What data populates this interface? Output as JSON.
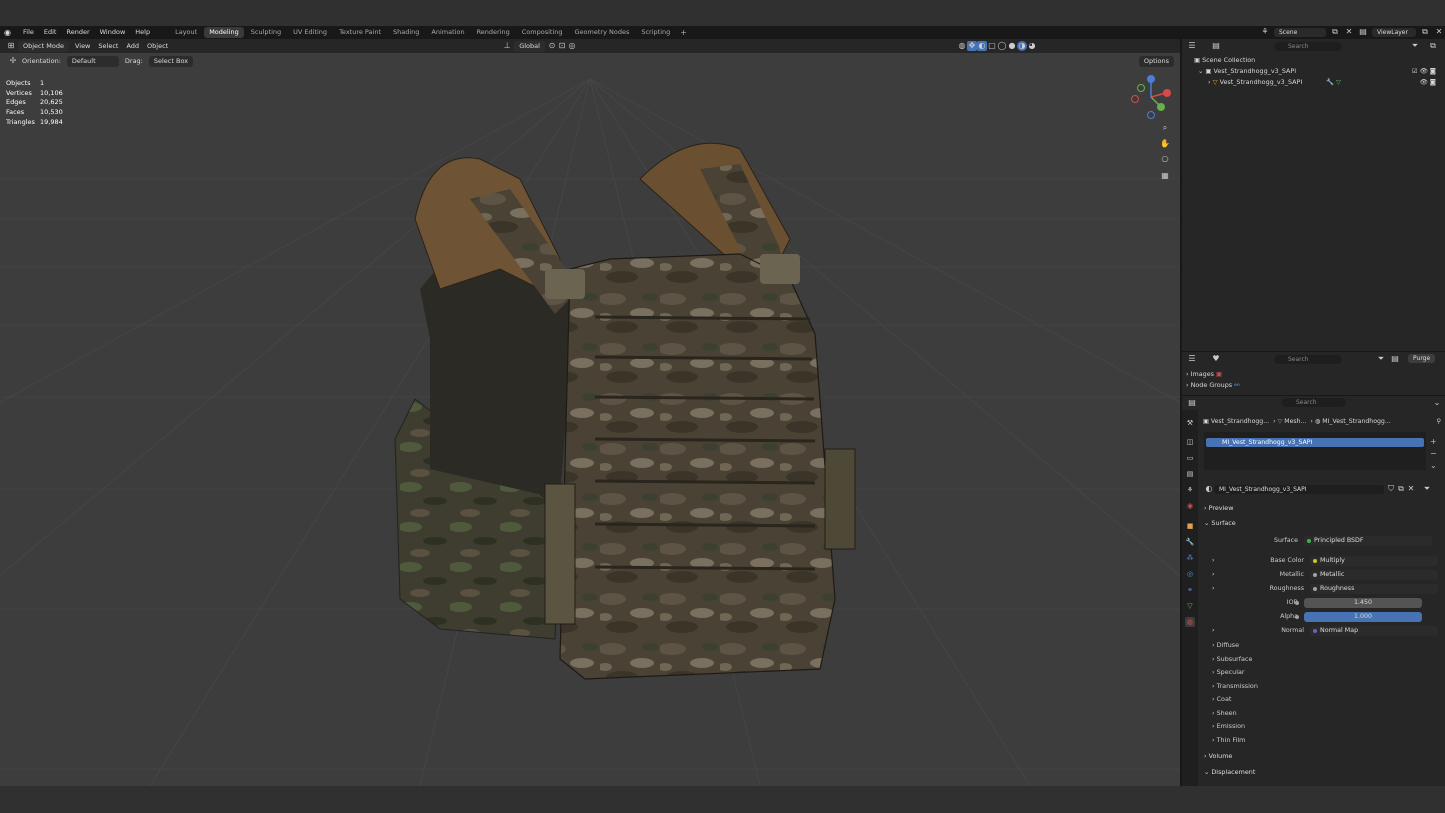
{
  "menubar": {
    "menus": [
      "File",
      "Edit",
      "Render",
      "Window",
      "Help"
    ],
    "workspaces": [
      "Layout",
      "Modeling",
      "Sculpting",
      "UV Editing",
      "Texture Paint",
      "Shading",
      "Animation",
      "Rendering",
      "Compositing",
      "Geometry Nodes",
      "Scripting"
    ],
    "active_workspace": "Modeling",
    "scene": "Scene",
    "view_layer": "ViewLayer"
  },
  "viewport": {
    "mode": "Object Mode",
    "menus": [
      "View",
      "Select",
      "Add",
      "Object"
    ],
    "orientation_global": "Global",
    "orientation_label": "Orientation:",
    "orientation_value": "Default",
    "drag_label": "Drag:",
    "drag_value": "Select Box",
    "options_label": "Options",
    "stats": [
      {
        "k": "Objects",
        "v": "1"
      },
      {
        "k": "Vertices",
        "v": "10,106"
      },
      {
        "k": "Edges",
        "v": "20,625"
      },
      {
        "k": "Faces",
        "v": "10,530"
      },
      {
        "k": "Triangles",
        "v": "19,984"
      }
    ]
  },
  "outliner": {
    "search_placeholder": "Search",
    "collection": "Scene Collection",
    "items": [
      {
        "label": "Vest_Strandhogg_v3_SAPI"
      },
      {
        "label": "Vest_Strandhogg_v3_SAPI"
      }
    ]
  },
  "blendfile": {
    "search_placeholder": "Search",
    "purge_label": "Purge",
    "items": [
      "Images",
      "Node Groups"
    ]
  },
  "properties": {
    "search_placeholder": "Search",
    "breadcrumb": [
      "Vest_Strandhogg...",
      "Mesh...",
      "MI_Vest_Strandhogg..."
    ],
    "material_slot": "MI_Vest_Strandhogg_v3_SAPI",
    "material_name": "MI_Vest_Strandhogg_v3_SAPI",
    "sections": {
      "preview": "Preview",
      "surface": "Surface",
      "volume": "Volume",
      "displacement": "Displacement"
    },
    "surface_rows": [
      {
        "label": "Surface",
        "value": "Principled BSDF",
        "dot": "#3cb44b"
      },
      {
        "label": "Base Color",
        "value": "Multiply",
        "dot": "#c7c729"
      },
      {
        "label": "Metallic",
        "value": "Metallic",
        "dot": "#a1a1a1"
      },
      {
        "label": "Roughness",
        "value": "Roughness",
        "dot": "#a1a1a1"
      },
      {
        "label": "IOR",
        "value": "1.450",
        "dot": "#a1a1a1"
      },
      {
        "label": "Alpha",
        "value": "1.000",
        "dot": "#a1a1a1"
      },
      {
        "label": "Normal",
        "value": "Normal Map",
        "dot": "#6363c7"
      }
    ],
    "subpanels": [
      "Diffuse",
      "Subsurface",
      "Specular",
      "Transmission",
      "Coat",
      "Sheen",
      "Emission",
      "Thin Film"
    ]
  },
  "colors": {
    "accent": "#4772b3",
    "header": "#262626",
    "viewport": "#3d3d3d"
  }
}
